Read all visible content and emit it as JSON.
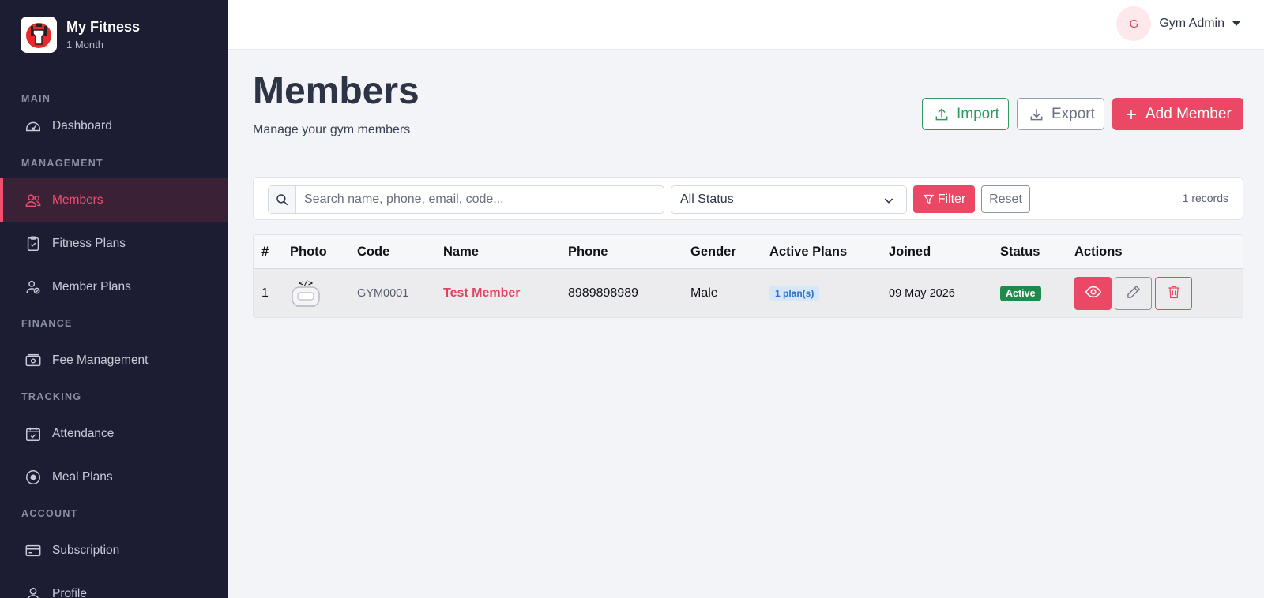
{
  "brand": {
    "name": "My Fitness",
    "subtitle": "1 Month"
  },
  "sidebar": {
    "sections": [
      {
        "label": "MAIN"
      },
      {
        "label": "MANAGEMENT"
      },
      {
        "label": "FINANCE"
      },
      {
        "label": "TRACKING"
      },
      {
        "label": "ACCOUNT"
      }
    ],
    "items": [
      {
        "label": "Dashboard",
        "icon": "gauge-icon"
      },
      {
        "label": "Members",
        "icon": "users-icon",
        "active": true
      },
      {
        "label": "Fitness Plans",
        "icon": "clipboard-icon"
      },
      {
        "label": "Member Plans",
        "icon": "user-check-icon"
      },
      {
        "label": "Fee Management",
        "icon": "cash-icon"
      },
      {
        "label": "Attendance",
        "icon": "calendar-check-icon"
      },
      {
        "label": "Meal Plans",
        "icon": "plate-icon"
      },
      {
        "label": "Subscription",
        "icon": "credit-card-icon"
      },
      {
        "label": "Profile",
        "icon": "user-icon"
      }
    ]
  },
  "header": {
    "avatar_initial": "G",
    "user_name": "Gym Admin"
  },
  "page": {
    "title": "Members",
    "subtitle": "Manage your gym members",
    "import_label": "Import",
    "export_label": "Export",
    "add_label": "Add Member"
  },
  "filters": {
    "search_placeholder": "Search name, phone, email, code...",
    "status_value": "All Status",
    "filter_label": "Filter",
    "reset_label": "Reset",
    "records": "1 records"
  },
  "table": {
    "columns": [
      "#",
      "Photo",
      "Code",
      "Name",
      "Phone",
      "Gender",
      "Active Plans",
      "Joined",
      "Status",
      "Actions"
    ],
    "rows": [
      {
        "index": "1",
        "code": "GYM0001",
        "name": "Test Member",
        "phone": "8989898989",
        "gender": "Male",
        "active_plans": "1 plan(s)",
        "joined": "09 May 2026",
        "status": "Active"
      }
    ]
  },
  "colors": {
    "accent": "#ea4865",
    "sidebar_bg": "#1c1d33",
    "import_green": "#2e9a60",
    "status_active": "#1e8a4c"
  }
}
